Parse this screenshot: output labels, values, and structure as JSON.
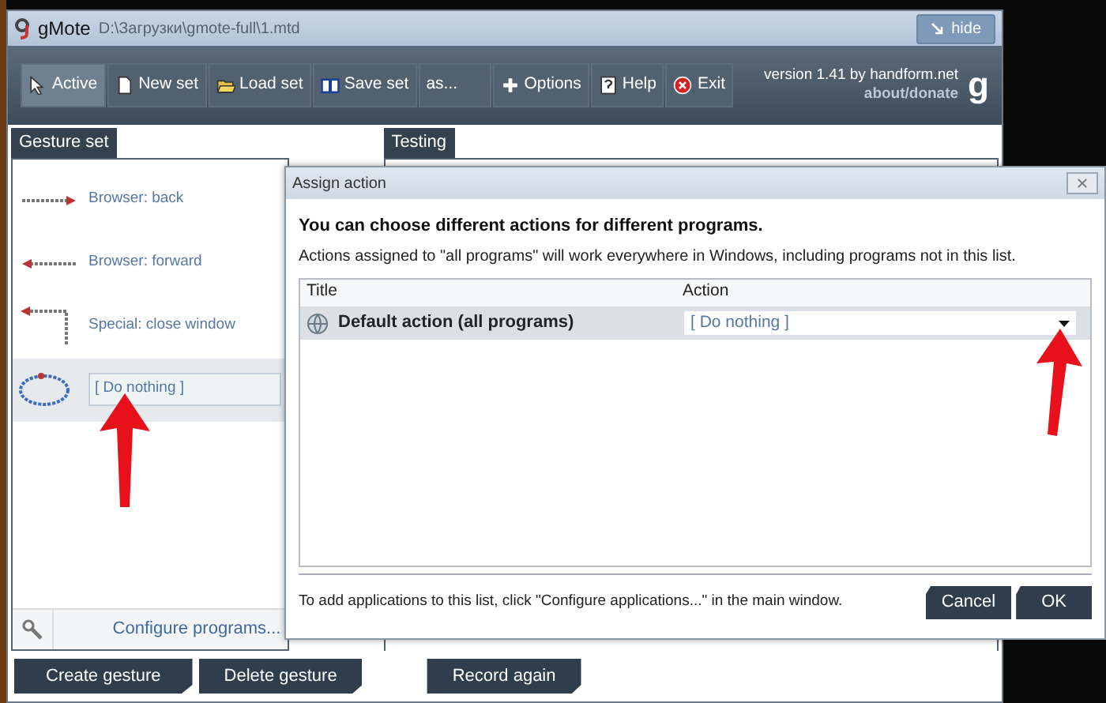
{
  "window": {
    "title": "gMote",
    "path": "D:\\Загрузки\\gmote-full\\1.mtd",
    "hide_button": "hide"
  },
  "toolbar": [
    {
      "kind": "cursor",
      "label": "Active",
      "selected": true
    },
    {
      "kind": "page",
      "label": "New set",
      "selected": false
    },
    {
      "kind": "folder",
      "label": "Load set",
      "selected": false
    },
    {
      "kind": "book",
      "label": "Save set",
      "selected": false
    },
    {
      "kind": "plain",
      "label": "as...",
      "selected": false
    },
    {
      "kind": "plus",
      "label": "Options",
      "selected": false
    },
    {
      "kind": "help",
      "label": "Help",
      "selected": false
    },
    {
      "kind": "exit",
      "label": "Exit",
      "selected": false
    }
  ],
  "about": {
    "version": "version 1.41 by handform.net",
    "donate": "about/donate",
    "logo": "g"
  },
  "gesture_set": {
    "tab": "Gesture set",
    "items": [
      {
        "kind": "right",
        "label": "Browser: back",
        "selected": false
      },
      {
        "kind": "left",
        "label": "Browser: forward",
        "selected": false
      },
      {
        "kind": "corner",
        "label": "Special: close window",
        "selected": false
      },
      {
        "kind": "loop",
        "label": "[ Do nothing ]",
        "selected": true
      }
    ],
    "configure": "Configure programs..."
  },
  "testing": {
    "tab": "Testing"
  },
  "bottom_buttons": [
    "Create gesture",
    "Delete gesture",
    "Record again"
  ],
  "dialog": {
    "title": "Assign action",
    "heading": "You can choose different actions for different programs.",
    "text": "Actions assigned to \"all programs\" will work everywhere in Windows, including programs not in this list.",
    "columns": [
      "Title",
      "Action"
    ],
    "rows": [
      {
        "title": "Default action (all programs)",
        "action": "[ Do nothing ]",
        "selected": true
      }
    ],
    "footer": "To add applications to this list, click \"Configure applications...\" in the main window.",
    "buttons": [
      "Cancel",
      "OK"
    ]
  }
}
